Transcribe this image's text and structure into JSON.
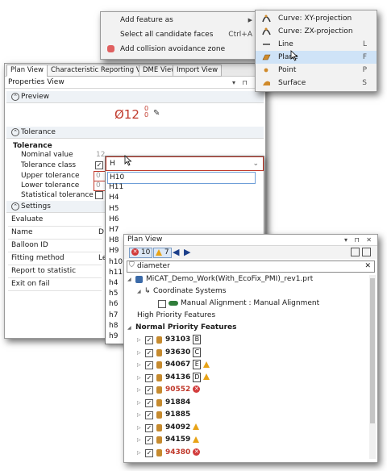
{
  "context_menu": {
    "items": [
      {
        "label": "Add feature as",
        "shortcut": "",
        "submenu_arrow": "▶"
      },
      {
        "label": "Select all candidate faces",
        "shortcut": "Ctrl+A"
      },
      {
        "label": "Add collision avoidance zone",
        "shortcut": "",
        "icon": "cube-icon"
      }
    ]
  },
  "submenu": {
    "items": [
      {
        "label": "Curve: XY-projection",
        "shortcut": "",
        "icon": "curve-icon"
      },
      {
        "label": "Curve: ZX-projection",
        "shortcut": "",
        "icon": "curve-icon"
      },
      {
        "label": "Line",
        "shortcut": "L",
        "icon": "line-icon"
      },
      {
        "label": "Plane",
        "shortcut": "F",
        "icon": "plane-icon",
        "highlighted": true
      },
      {
        "label": "Point",
        "shortcut": "P",
        "icon": "point-icon"
      },
      {
        "label": "Surface",
        "shortcut": "S",
        "icon": "surface-icon"
      }
    ]
  },
  "props": {
    "tabs": [
      "Plan View",
      "Characteristic Reporting View",
      "DME View",
      "Import View"
    ],
    "title": "Properties View",
    "title_controls": "▾ ⊓ ✕",
    "preview_section": "Preview",
    "preview_symbol": "Ø12",
    "preview_tol_upper": "0",
    "preview_tol_lower": "0",
    "tolerance_section": "Tolerance",
    "tolerance_header": "Tolerance",
    "nominal_label": "Nominal value",
    "nominal_value": "12",
    "class_label": "Tolerance class",
    "upper_label": "Upper tolerance",
    "upper_value": "0",
    "lower_label": "Lower tolerance",
    "lower_value": "0",
    "statistical_label": "Statistical tolerance",
    "settings_section": "Settings",
    "settings_rows": [
      "Evaluate",
      "Name",
      "Balloon ID",
      "Fitting method",
      "Report to statistic",
      "Exit on fail"
    ],
    "settings_values": [
      "",
      "D",
      "",
      "Le",
      "",
      ""
    ]
  },
  "dropdown": {
    "input_value": "H",
    "items": [
      "H10",
      "H11",
      "H4",
      "H5",
      "H6",
      "H7",
      "H8",
      "H9",
      "h10",
      "h11",
      "h4",
      "h5",
      "h6",
      "h7",
      "h8",
      "h9"
    ]
  },
  "plan": {
    "title": "Plan View",
    "title_controls": "▾ ⊓ ✕",
    "error_count": "10",
    "warning_count": "7",
    "search_value": "diameter",
    "root": "MiCAT_Demo_Work(With_EcoFix_PMI)_rev1.prt",
    "coord_systems": "Coordinate Systems",
    "manual_alignment": "Manual Alignment : Manual Alignment",
    "high_priority": "High Priority Features",
    "normal_priority": "Normal Priority Features",
    "features": [
      {
        "id": "93103",
        "badge": "B",
        "status": ""
      },
      {
        "id": "93630",
        "badge": "C",
        "status": ""
      },
      {
        "id": "94067",
        "badge": "E",
        "status": "warning"
      },
      {
        "id": "94136",
        "badge": "D",
        "status": "warning"
      },
      {
        "id": "90552",
        "badge": "",
        "status": "error"
      },
      {
        "id": "91884",
        "badge": "",
        "status": ""
      },
      {
        "id": "91885",
        "badge": "",
        "status": ""
      },
      {
        "id": "94092",
        "badge": "",
        "status": "warning"
      },
      {
        "id": "94159",
        "badge": "",
        "status": "warning"
      },
      {
        "id": "94380",
        "badge": "",
        "status": "error"
      }
    ]
  },
  "colors": {
    "accent": "#cfe3f7",
    "error": "#c0392b",
    "warning": "#e8a317",
    "feature_icon": "#c68a2e"
  }
}
